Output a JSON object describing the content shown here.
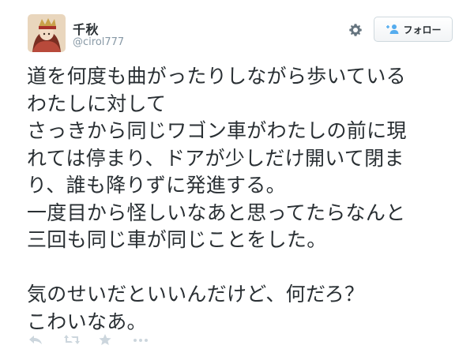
{
  "user": {
    "display_name": "千秋",
    "handle": "@cirol777",
    "avatar_icon": "avatar-icon"
  },
  "header": {
    "settings_icon": "gear-icon",
    "follow_label": "フォロー",
    "follow_icon": "add-user-icon"
  },
  "tweet": {
    "lines": [
      "道を何度も曲がったりしながら歩いている",
      "わたしに対して",
      "さっきから同じワゴン車がわたしの前に現",
      "れては停まり、ドアが少しだけ開いて閉ま",
      "り、誰も降りずに発進する。",
      "一度目から怪しいなあと思ってたらなんと",
      "三回も同じ車が同じことをした。",
      "",
      "気のせいだといいんだけど、何だろ？",
      "こわいなあ。"
    ]
  },
  "actions": {
    "icons": [
      "reply-icon",
      "retweet-icon",
      "favorite-icon",
      "more-icon"
    ]
  },
  "colors": {
    "text": "#292f33",
    "muted": "#8899a6",
    "accent": "#55acee",
    "icon": "#ccd6dd"
  }
}
